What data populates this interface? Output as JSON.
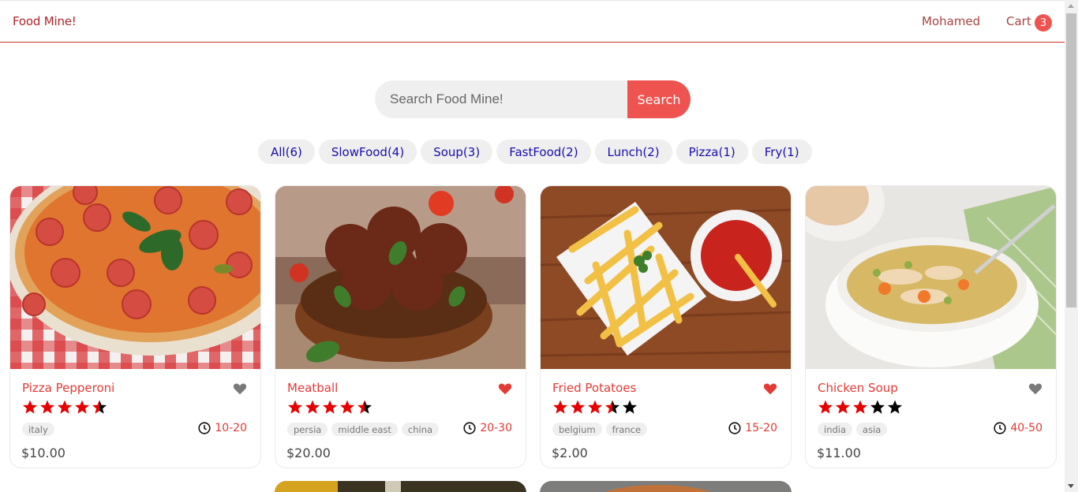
{
  "header": {
    "logo": "Food Mine!",
    "user": "Mohamed",
    "cart_label": "Cart",
    "cart_count": "3"
  },
  "search": {
    "placeholder": "Search Food Mine!",
    "button": "Search"
  },
  "tags": [
    "All(6)",
    "SlowFood(4)",
    "Soup(3)",
    "FastFood(2)",
    "Lunch(2)",
    "Pizza(1)",
    "Fry(1)"
  ],
  "foods": [
    {
      "name": "Pizza Pepperoni",
      "favorite": false,
      "stars": 4.5,
      "origins": [
        "italy"
      ],
      "cook_time": "10-20",
      "price": "$10.00",
      "image": "pizza"
    },
    {
      "name": "Meatball",
      "favorite": true,
      "stars": 4.5,
      "origins": [
        "persia",
        "middle east",
        "china"
      ],
      "cook_time": "20-30",
      "price": "$20.00",
      "image": "meatball"
    },
    {
      "name": "Fried Potatoes",
      "favorite": true,
      "stars": 3.5,
      "origins": [
        "belgium",
        "france"
      ],
      "cook_time": "15-20",
      "price": "$2.00",
      "image": "fries"
    },
    {
      "name": "Chicken Soup",
      "favorite": false,
      "stars": 3,
      "origins": [
        "india",
        "asia"
      ],
      "cook_time": "40-50",
      "price": "$11.00",
      "image": "soup"
    }
  ],
  "colors": {
    "accent": "#ef5350",
    "title": "#e53935",
    "favorite_on": "#e53935",
    "favorite_off": "#7a7a7a",
    "star_filled": "#e60000",
    "star_empty": "#000000",
    "tag_text": "#1a0dab"
  }
}
